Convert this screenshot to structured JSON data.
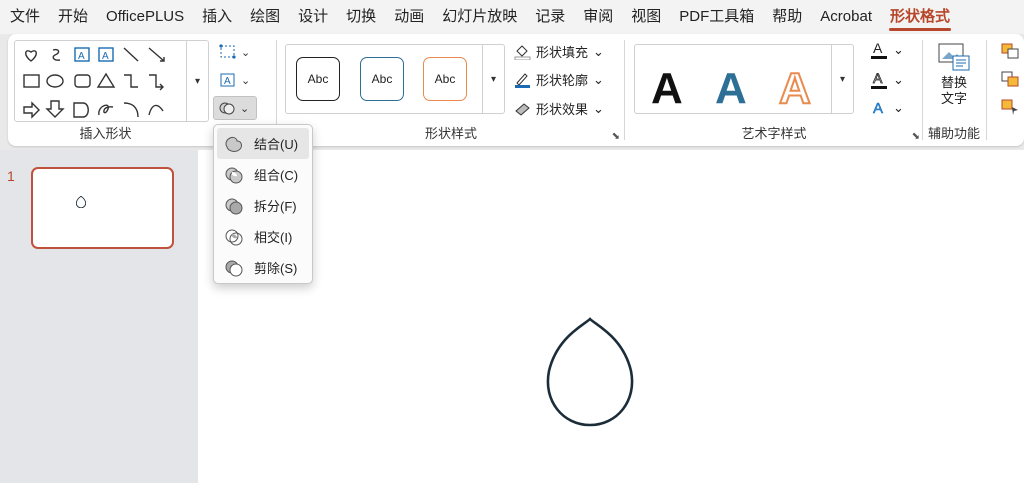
{
  "menu": {
    "tabs": [
      {
        "label": "文件"
      },
      {
        "label": "开始"
      },
      {
        "label": "OfficePLUS"
      },
      {
        "label": "插入"
      },
      {
        "label": "绘图"
      },
      {
        "label": "设计"
      },
      {
        "label": "切换"
      },
      {
        "label": "动画"
      },
      {
        "label": "幻灯片放映"
      },
      {
        "label": "记录"
      },
      {
        "label": "审阅"
      },
      {
        "label": "视图"
      },
      {
        "label": "PDF工具箱"
      },
      {
        "label": "帮助"
      },
      {
        "label": "Acrobat"
      },
      {
        "label": "形状格式"
      }
    ],
    "active_tab": "形状格式"
  },
  "ribbon": {
    "insert_shapes": {
      "label": "插入形状"
    },
    "shape_styles": {
      "label": "形状样式",
      "samples": [
        "Abc",
        "Abc",
        "Abc"
      ],
      "fill": "形状填充",
      "outline": "形状轮廓",
      "effects": "形状效果"
    },
    "wordart": {
      "label": "艺术字样式",
      "samples": [
        "A",
        "A",
        "A"
      ]
    },
    "accessibility": {
      "label": "辅助功能",
      "alt_text_line1": "替换",
      "alt_text_line2": "文字"
    }
  },
  "merge_menu": {
    "items": [
      {
        "label": "结合(U)"
      },
      {
        "label": "组合(C)"
      },
      {
        "label": "拆分(F)"
      },
      {
        "label": "相交(I)"
      },
      {
        "label": "剪除(S)"
      }
    ]
  },
  "slides": {
    "current_number": "1"
  },
  "colors": {
    "accent": "#b7472a",
    "teardrop_stroke": "#1c2d3a",
    "wordart_blue": "#2e6f96",
    "wordart_orange": "#e98a4f"
  }
}
